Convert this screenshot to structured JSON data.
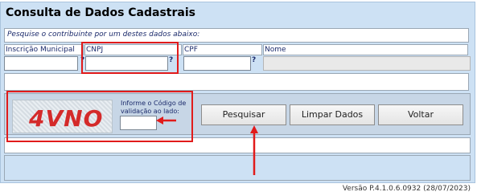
{
  "title": "Consulta de Dados Cadastrais",
  "hint": "Pesquise o contribuinte por um destes dados abaixo:",
  "fields": {
    "inscricao": {
      "label": "Inscrição Municipal",
      "help": "?"
    },
    "cnpj": {
      "label": "CNPJ",
      "help": "?"
    },
    "cpf": {
      "label": "CPF",
      "help": "?"
    },
    "nome": {
      "label": "Nome"
    }
  },
  "captcha": {
    "image_text": "4VNO",
    "label": "Informe o Código de validação ao lado:"
  },
  "buttons": {
    "search": "Pesquisar",
    "clear": "Limpar Dados",
    "back": "Voltar"
  },
  "version": "Versão P.4.1.0.6.0932 (28/07/2023)",
  "colors": {
    "panel": "#cde1f4",
    "highlight": "#e11b1b",
    "captcha_text": "#d42a2a"
  }
}
